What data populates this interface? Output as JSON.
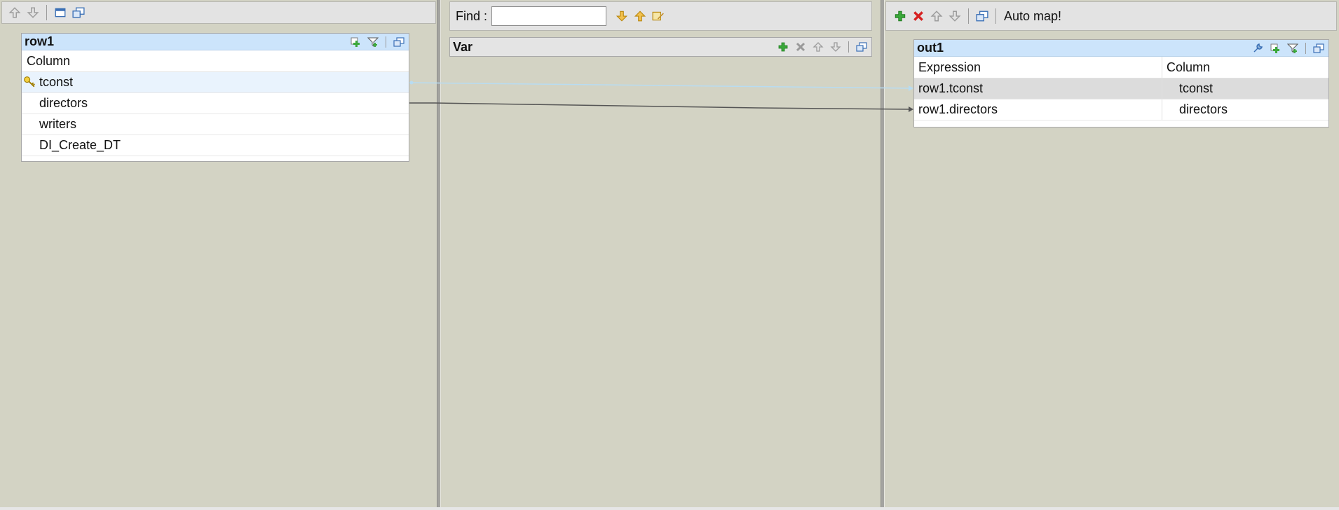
{
  "left_toolbar": {
    "icons": [
      "move-up-icon",
      "move-down-icon",
      "minimize-icon",
      "window-icon"
    ]
  },
  "middle_toolbar": {
    "find_label": "Find :",
    "find_value": "",
    "icons": [
      "find-next-icon",
      "find-previous-icon",
      "highlight-icon"
    ]
  },
  "right_toolbar": {
    "icons": [
      "add-icon",
      "remove-icon",
      "move-up-icon",
      "move-down-icon",
      "window-icon"
    ],
    "automap_label": "Auto map!"
  },
  "input_table": {
    "title": "row1",
    "column_header": "Column",
    "rows": [
      {
        "name": "tconst",
        "key": true
      },
      {
        "name": "directors",
        "key": false
      },
      {
        "name": "writers",
        "key": false
      },
      {
        "name": "DI_Create_DT",
        "key": false
      }
    ]
  },
  "var_table": {
    "title": "Var"
  },
  "output_table": {
    "title": "out1",
    "headers": {
      "expression": "Expression",
      "column": "Column"
    },
    "rows": [
      {
        "expression": "row1.tconst",
        "column": "tconst"
      },
      {
        "expression": "row1.directors",
        "column": "directors"
      }
    ]
  },
  "colors": {
    "background": "#d3d3c4",
    "header_blue": "#cce4fb",
    "selected_row": "#e9f3fd",
    "link_light": "#b8dcf2",
    "link_dark": "#555555"
  }
}
